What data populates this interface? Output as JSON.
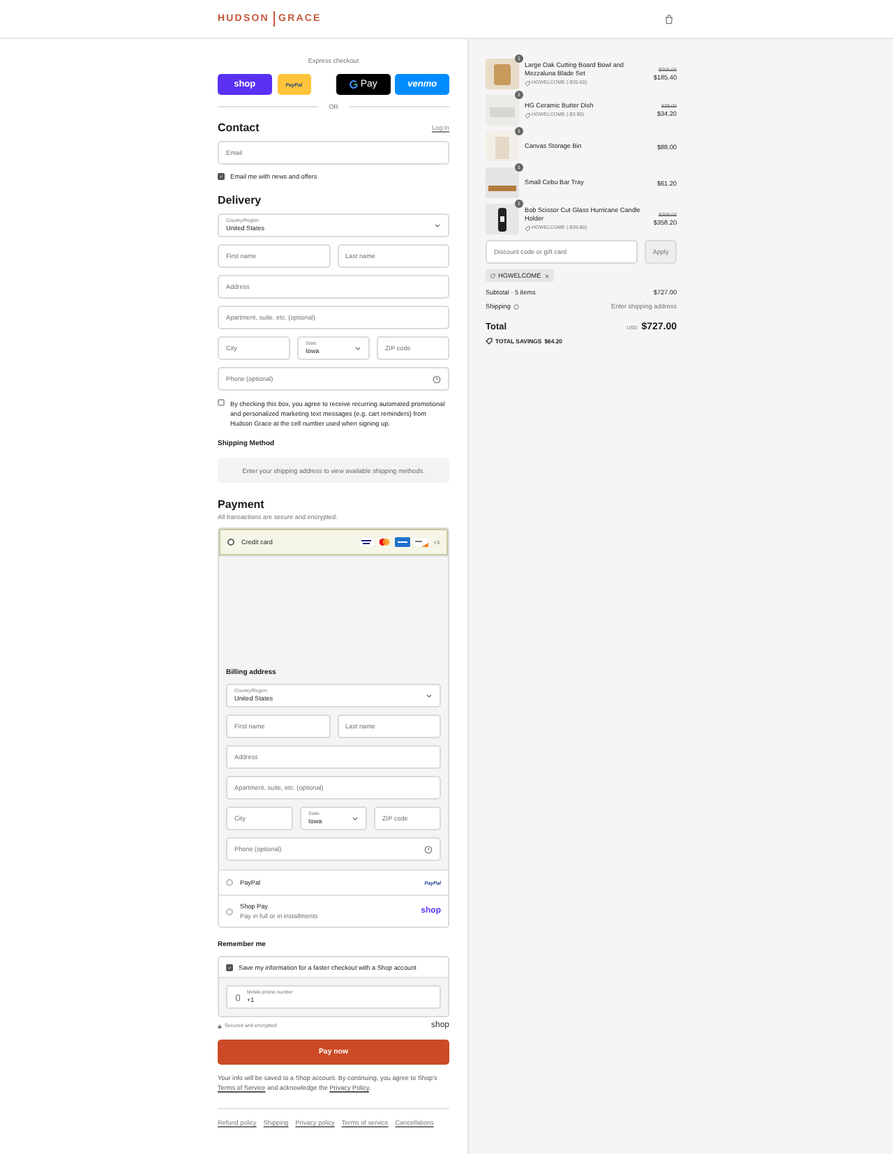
{
  "header": {
    "brand": [
      "HUDSON",
      "GRACE"
    ]
  },
  "express": {
    "label": "Express checkout",
    "buttons": [
      {
        "kind": "shop",
        "label": "shop"
      },
      {
        "kind": "paypal",
        "label": "PayPal"
      },
      {
        "kind": "gpay",
        "label": "Pay"
      },
      {
        "kind": "venmo",
        "label": "venmo"
      }
    ],
    "or_label": "OR"
  },
  "contact": {
    "title": "Contact",
    "login_link": "Log in",
    "email": {
      "placeholder": "Email"
    },
    "news": {
      "label": "Email me with news and offers",
      "checked": true
    }
  },
  "delivery": {
    "title": "Delivery",
    "rows": [
      [
        {
          "kind": "select",
          "label": "Country/Region",
          "value": "United States"
        }
      ],
      [
        {
          "kind": "text",
          "placeholder": "First name"
        },
        {
          "kind": "text",
          "placeholder": "Last name"
        }
      ],
      [
        {
          "kind": "text",
          "placeholder": "Address"
        }
      ],
      [
        {
          "kind": "text",
          "placeholder": "Apartment, suite, etc. (optional)"
        }
      ],
      [
        {
          "kind": "text",
          "placeholder": "City"
        },
        {
          "kind": "select",
          "label": "State",
          "value": "Iowa"
        },
        {
          "kind": "text",
          "placeholder": "ZIP code"
        }
      ],
      [
        {
          "kind": "phone",
          "placeholder": "Phone (optional)"
        }
      ]
    ],
    "sms": {
      "label": "By checking this box, you agree to receive recurring automated promotional and personalized marketing text messages (e.g. cart reminders) from Hudson Grace at the cell number used when signing up.",
      "checked": false
    }
  },
  "shipping_method": {
    "title": "Shipping Method",
    "message": "Enter your shipping address to view available shipping methods."
  },
  "payment": {
    "title": "Payment",
    "subtitle": "All transactions are secure and encrypted.",
    "methods": [
      {
        "kind": "card",
        "label": "Credit card",
        "selected": true,
        "more": "+3"
      },
      {
        "kind": "paypal",
        "label": "PayPal",
        "selected": false,
        "logo": "PayPal"
      },
      {
        "kind": "shop",
        "label": "Shop Pay",
        "sublabel": "Pay in full or in installments",
        "selected": false,
        "logo": "shop"
      }
    ],
    "billing": {
      "title": "Billing address",
      "rows": [
        [
          {
            "kind": "select",
            "label": "Country/Region",
            "value": "United States"
          }
        ],
        [
          {
            "kind": "text",
            "placeholder": "First name"
          },
          {
            "kind": "text",
            "placeholder": "Last name"
          }
        ],
        [
          {
            "kind": "text",
            "placeholder": "Address"
          }
        ],
        [
          {
            "kind": "text",
            "placeholder": "Apartment, suite, etc. (optional)"
          }
        ],
        [
          {
            "kind": "text",
            "placeholder": "City"
          },
          {
            "kind": "select",
            "label": "State",
            "value": "Iowa"
          },
          {
            "kind": "text",
            "placeholder": "ZIP code"
          }
        ],
        [
          {
            "kind": "phone",
            "placeholder": "Phone (optional)"
          }
        ]
      ]
    }
  },
  "remember": {
    "title": "Remember me",
    "save": {
      "label": "Save my information for a faster checkout with a Shop account",
      "checked": true
    },
    "mobile": {
      "label": "Mobile phone number",
      "value": "+1"
    },
    "secure_note": "Secured and encrypted",
    "shop_logo": "shop"
  },
  "pay_button": "Pay now",
  "disclaimer": {
    "before": "Your info will be saved to a Shop account. By continuing, you agree to Shop's ",
    "terms": "Terms of Service",
    "middle": " and acknowledge the ",
    "privacy": "Privacy Policy",
    "after": "."
  },
  "footer_links": [
    "Refund policy",
    "Shipping",
    "Privacy policy",
    "Terms of service",
    "Cancellations"
  ],
  "order": {
    "items": [
      {
        "name": "Large Oak Cutting Board Bowl and Mezzaluna Blade Set",
        "qty": "1",
        "discount": "HGWELCOME (-$20.60)",
        "original": "$206.00",
        "price": "$185.40"
      },
      {
        "name": "HG Ceramic Butter Dish",
        "qty": "1",
        "discount": "HGWELCOME (-$3.80)",
        "original": "$38.00",
        "price": "$34.20"
      },
      {
        "name": "Canvas Storage Bin",
        "qty": "1",
        "price": "$88.00"
      },
      {
        "name": "Small Cebu Bar Tray",
        "qty": "1",
        "price": "$61.20"
      },
      {
        "name": "Bob Scissor Cut Glass Hurricane Candle Holder",
        "qty": "1",
        "discount": "HGWELCOME (-$39.80)",
        "original": "$398.00",
        "price": "$358.20"
      }
    ],
    "discount_field": {
      "placeholder": "Discount code or gift card"
    },
    "apply_button": "Apply",
    "applied_code": "HGWELCOME",
    "subtotal": {
      "label": "Subtotal · 5 items",
      "value": "$727.00"
    },
    "shipping": {
      "label": "Shipping",
      "value": "Enter shipping address"
    },
    "total": {
      "label": "Total",
      "currency": "USD",
      "value": "$727.00"
    },
    "savings": {
      "label": "TOTAL SAVINGS",
      "value": "$64.20"
    }
  }
}
